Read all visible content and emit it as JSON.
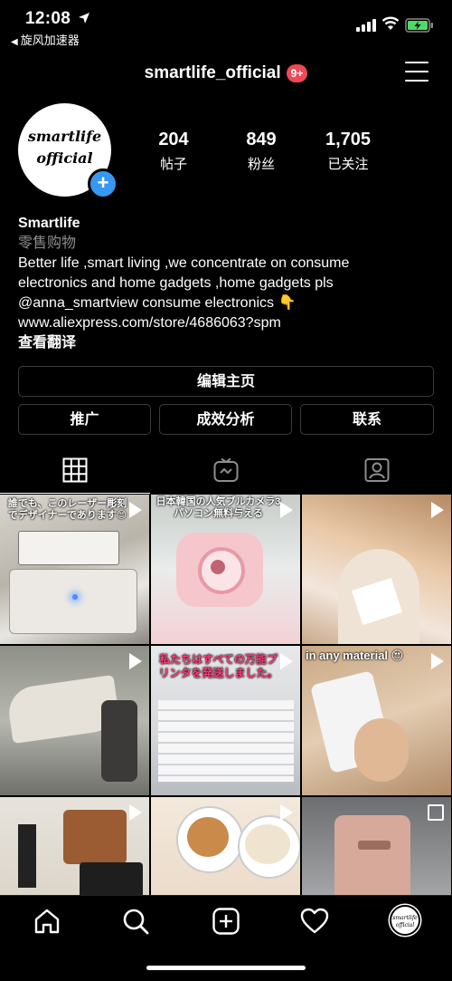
{
  "status_bar": {
    "time": "12:08",
    "back_app": "旋风加速器"
  },
  "header": {
    "username": "smartlife_official",
    "notification_badge": "9+"
  },
  "profile": {
    "avatar_line1": "smartlife",
    "avatar_line2": "official",
    "stats": [
      {
        "value": "204",
        "label": "帖子"
      },
      {
        "value": "849",
        "label": "粉丝"
      },
      {
        "value": "1,705",
        "label": "已关注"
      }
    ],
    "name": "Smartlife",
    "category": "零售购物",
    "bio_lines": [
      "Better life ,smart living ,we concentrate on consume",
      "electronics and home gadgets ,home gadgets pls",
      "@anna_smartview  consume electronics 👇",
      "www.aliexpress.com/store/4686063?spm"
    ],
    "see_translation": "查看翻译"
  },
  "buttons": {
    "edit_profile": "编辑主页",
    "promotions": "推广",
    "insights": "成效分析",
    "contact": "联系"
  },
  "tabs": [
    "grid-icon",
    "igtv-icon",
    "tagged-icon"
  ],
  "posts": [
    {
      "caption": "誰でも、このレーザー彫刻でデザイナーであります😊",
      "media": "video"
    },
    {
      "caption": "日本韓国の人気ブルカメラ3パソコン無料与える",
      "media": "video"
    },
    {
      "caption": "",
      "media": "video"
    },
    {
      "caption": "",
      "media": "video"
    },
    {
      "caption": "私たちはすべての万能プリンタを発送しました。",
      "media": "video"
    },
    {
      "caption": "in any material 😍",
      "media": "video"
    },
    {
      "caption": "",
      "media": "video"
    },
    {
      "caption": "",
      "media": "video"
    },
    {
      "caption": "",
      "media": "carousel"
    }
  ],
  "colors": {
    "background": "#000000",
    "badge": "#ed4956",
    "accent_blue": "#3897f0",
    "secondary_text": "#8e8e8e"
  }
}
